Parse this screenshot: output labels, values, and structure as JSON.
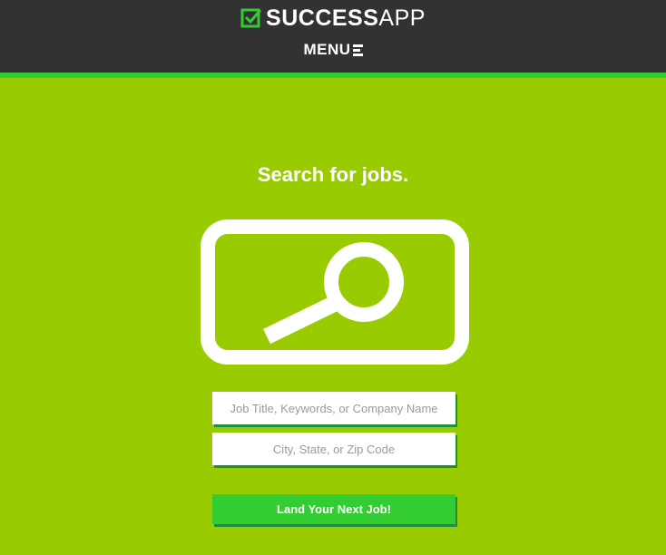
{
  "header": {
    "logo_bold": "SUCCESS",
    "logo_light": "APP",
    "menu_label": "MENU"
  },
  "main": {
    "headline": "Search for jobs.",
    "job_field_placeholder": "Job Title, Keywords, or Company Name",
    "location_field_placeholder": "City, State, or Zip Code",
    "cta_label": "Land Your Next Job!"
  },
  "colors": {
    "background": "#99cc00",
    "header": "#323232",
    "accent": "#33cc33",
    "shadow": "#1e8f3a"
  },
  "icons": {
    "logo": "checkbox-icon",
    "menu": "hamburger-icon",
    "hero": "search-icon"
  }
}
